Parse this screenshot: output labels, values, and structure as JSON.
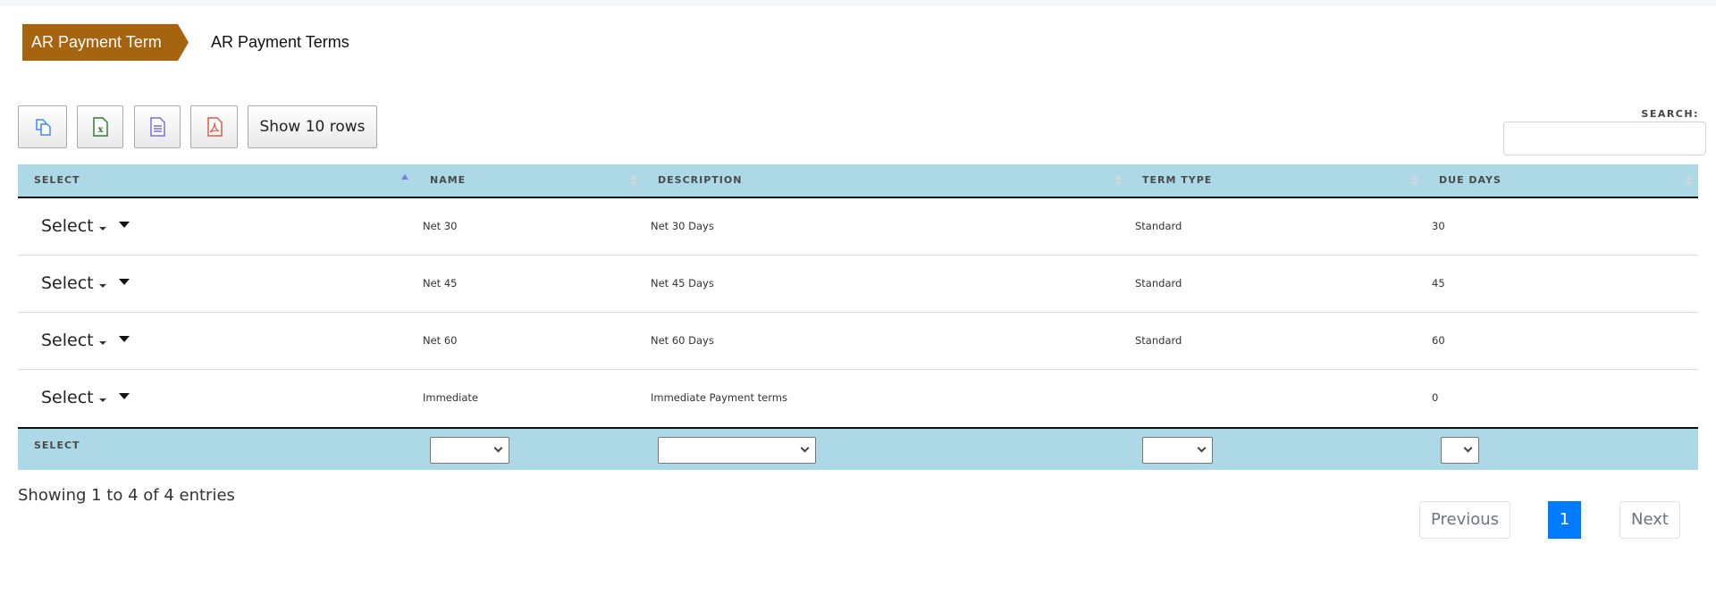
{
  "breadcrumb": {
    "parent": "AR Payment Term",
    "current": "AR Payment Terms"
  },
  "toolbar": {
    "copy_icon": "copy-icon",
    "excel_icon": "excel-icon",
    "csv_icon": "csv-document-icon",
    "pdf_icon": "pdf-icon",
    "show_rows_label": "Show 10 rows"
  },
  "search": {
    "label": "SEARCH:",
    "value": ""
  },
  "table": {
    "columns": [
      "SELECT",
      "NAME",
      "DESCRIPTION",
      "TERM TYPE",
      "DUE DAYS"
    ],
    "rows": [
      {
        "select": "Select",
        "name": "Net 30",
        "description": "Net 30 Days",
        "term_type": "Standard",
        "due_days": "30"
      },
      {
        "select": "Select",
        "name": "Net 45",
        "description": "Net 45 Days",
        "term_type": "Standard",
        "due_days": "45"
      },
      {
        "select": "Select",
        "name": "Net 60",
        "description": "Net 60 Days",
        "term_type": "Standard",
        "due_days": "60"
      },
      {
        "select": "Select",
        "name": "Immediate",
        "description": "Immediate Payment terms",
        "term_type": "",
        "due_days": "0"
      }
    ],
    "footer": {
      "label": "SELECT",
      "filters": {
        "name": "",
        "description": "",
        "term_type": "",
        "due_days": ""
      }
    }
  },
  "info": "Showing 1 to 4 of 4 entries",
  "pagination": {
    "previous": "Previous",
    "current": "1",
    "next": "Next"
  },
  "colors": {
    "breadcrumb_bg": "#a7640f",
    "header_bg": "#add8e6",
    "page_active": "#007bff"
  }
}
